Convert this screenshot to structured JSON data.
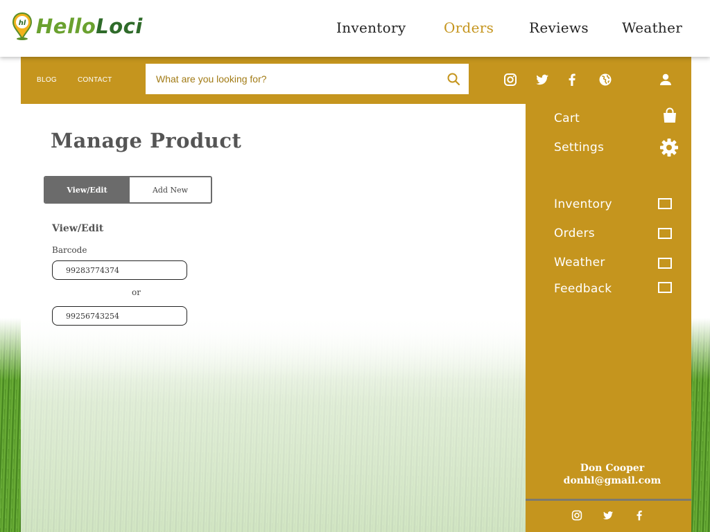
{
  "brand": {
    "logo_badge": "hl",
    "name_part1": "Hello",
    "name_part2": "Loci"
  },
  "main_nav": [
    {
      "label": "Inventory",
      "active": false
    },
    {
      "label": "Orders",
      "active": true
    },
    {
      "label": "Reviews",
      "active": false
    },
    {
      "label": "Weather",
      "active": false
    }
  ],
  "header": {
    "links": [
      "BLOG",
      "CONTACT"
    ],
    "search": {
      "placeholder": "What are you looking for?",
      "icon": "search-icon"
    },
    "social_icons": [
      "instagram-icon",
      "twitter-icon",
      "facebook-icon",
      "globe-icon"
    ],
    "user_icon": "user-icon"
  },
  "content": {
    "title": "Manage Product",
    "tabs": [
      {
        "label": "View/Edit",
        "active": true
      },
      {
        "label": "Add New",
        "active": false
      }
    ],
    "section_heading": "View/Edit",
    "barcode_label": "Barcode",
    "barcode_value_1": "99283774374",
    "or_text": "or",
    "barcode_value_2": "99256743254"
  },
  "sidebar": {
    "top_items": [
      {
        "label": "Cart",
        "icon": "shopping-bag-icon"
      },
      {
        "label": "Settings",
        "icon": "gear-icon"
      }
    ],
    "check_items": [
      {
        "label": "Inventory",
        "checked": false
      },
      {
        "label": "Orders",
        "checked": false
      },
      {
        "label": "Weather",
        "checked": false
      },
      {
        "label": "Feedback",
        "checked": false
      }
    ],
    "user": {
      "name": "Don Cooper",
      "email": "donhl@gmail.com"
    },
    "footer_icons": [
      "instagram-icon",
      "twitter-icon",
      "facebook-icon"
    ]
  },
  "colors": {
    "accent_gold": "#c5951e",
    "brand_light_green": "#6aa12f",
    "brand_dark_green": "#2f6b2a",
    "active_tab": "#6b6b6b"
  }
}
